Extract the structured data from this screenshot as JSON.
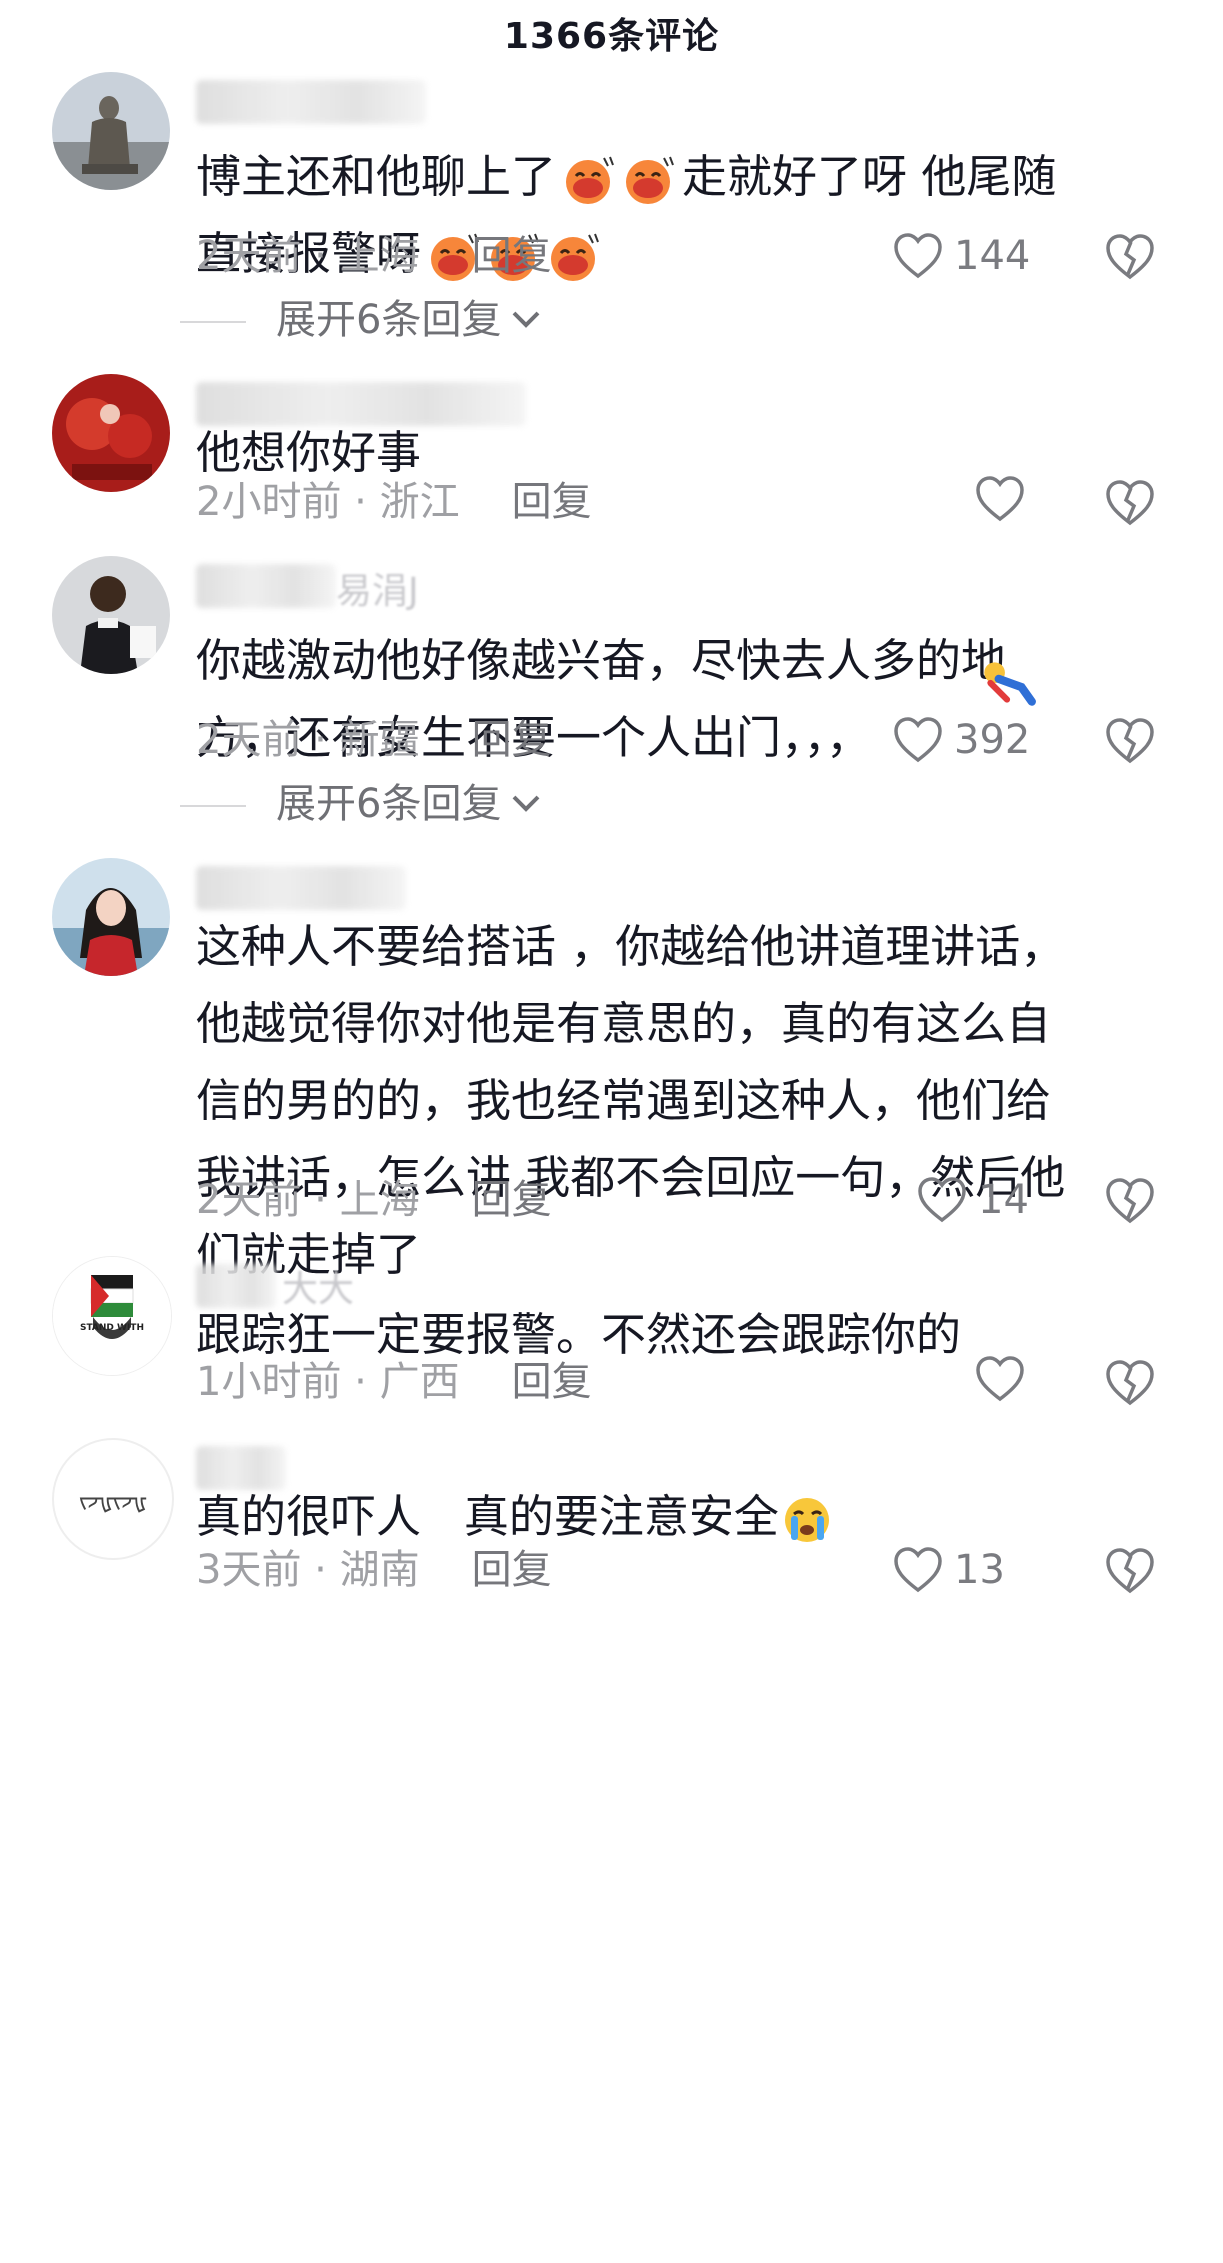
{
  "header": {
    "title": "1366条评论"
  },
  "comments": [
    {
      "avatar": "statue-avatar",
      "text_before": "博主还和他聊上了",
      "emojis_inline": 2,
      "text_after": "走就好了呀 他尾随\n直接报警呀",
      "emojis_end": 3,
      "time": "2天前",
      "location": "上海",
      "reply": "回复",
      "likes": "144",
      "expand": "展开6条回复"
    },
    {
      "avatar": "red-decor-avatar",
      "text": "他想你好事",
      "time": "2小时前",
      "location": "浙江",
      "reply": "回复",
      "likes": ""
    },
    {
      "avatar": "child-waiter-avatar",
      "username_fragment": "易涓J",
      "text": "你越激动他好像越兴奋，尽快去人多的地\n方，还有女生不要一个人出门，，，",
      "time": "2天前",
      "location": "新疆",
      "reply": "回复",
      "likes": "392",
      "expand": "展开6条回复"
    },
    {
      "avatar": "woman-portrait-avatar",
      "text": "这种人不要给搭话 ，你越给他讲道理讲话，\n他越觉得你对他是有意思的，真的有这么自\n信的男的的，我也经常遇到这种人，他们给\n我讲话，怎么讲 我都不会回应一句，然后他\n们就走掉了",
      "time": "2天前",
      "location": "上海",
      "reply": "回复",
      "likes": "14"
    },
    {
      "avatar": "stand-with-avatar",
      "username_fragment": "大大",
      "avatar_text": "STAND WITH",
      "text": "跟踪狂一定要报警。不然还会跟踪你的",
      "time": "1小时前",
      "location": "广西",
      "reply": "回复",
      "likes": ""
    },
    {
      "avatar": "white-avatar",
      "avatar_text": "ᡕᠵᡁᡕᠵᡁ",
      "text": "真的很吓人   真的要注意安全",
      "time": "3天前",
      "location": "湖南",
      "reply": "回复",
      "likes": "13"
    }
  ],
  "colors": {
    "text": "#161823",
    "meta": "#9fa0a4",
    "icon": "#7a7b80"
  }
}
